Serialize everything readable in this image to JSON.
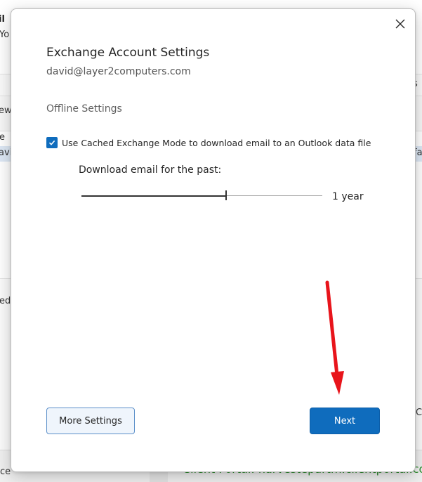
{
  "background": {
    "top_left_line1": "il",
    "top_left_line2": "Yo",
    "ribbon_left": "ew",
    "list_left_row1": "e",
    "list_left_row2": "avio",
    "list_right_ribbon": "s",
    "list_right_row": "fa",
    "lower_left": "ed",
    "footer_left": "ce",
    "footer_right_cut": "C",
    "portal_text": "Client Portal: harvestepartm.clientportal.com"
  },
  "dialog": {
    "title": "Exchange Account Settings",
    "email": "david@layer2computers.com",
    "section_heading": "Offline Settings",
    "cached_mode": {
      "checked": true,
      "label": "Use Cached Exchange Mode to download email to an Outlook data file"
    },
    "download_label": "Download email for the past:",
    "slider": {
      "value_text": "1 year",
      "position_fraction": 0.6
    },
    "buttons": {
      "more_settings": "More Settings",
      "next": "Next"
    },
    "close_icon": "close-icon"
  },
  "annotation": {
    "arrow_color": "#e8141b",
    "icon": "red-arrow-icon"
  },
  "colors": {
    "accent": "#0f6cbd",
    "secondary_button_bg": "#eff5fc",
    "secondary_button_border": "#5b8fc9",
    "portal_text": "#2f8f2f"
  }
}
